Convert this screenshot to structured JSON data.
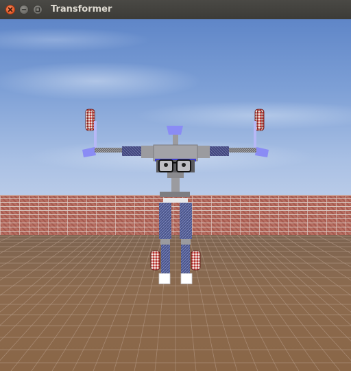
{
  "window": {
    "title": "Transformer",
    "controls": {
      "close_icon": "close-icon",
      "minimize_icon": "minimize-icon",
      "maximize_icon": "maximize-icon"
    }
  },
  "scene": {
    "sky_color": "#7ea0d6",
    "wall_color": "#b36b60",
    "floor_color": "#8a6647",
    "robot": {
      "head_color": "#8a8cf5",
      "torso_color": "#9a9a9e",
      "arm_color": "#4a4f8e",
      "hand_color": "#8a8cf5",
      "leg_color": "#4f5a92",
      "foot_color": "#ffffff",
      "wheel_color": "#b8302c"
    }
  }
}
